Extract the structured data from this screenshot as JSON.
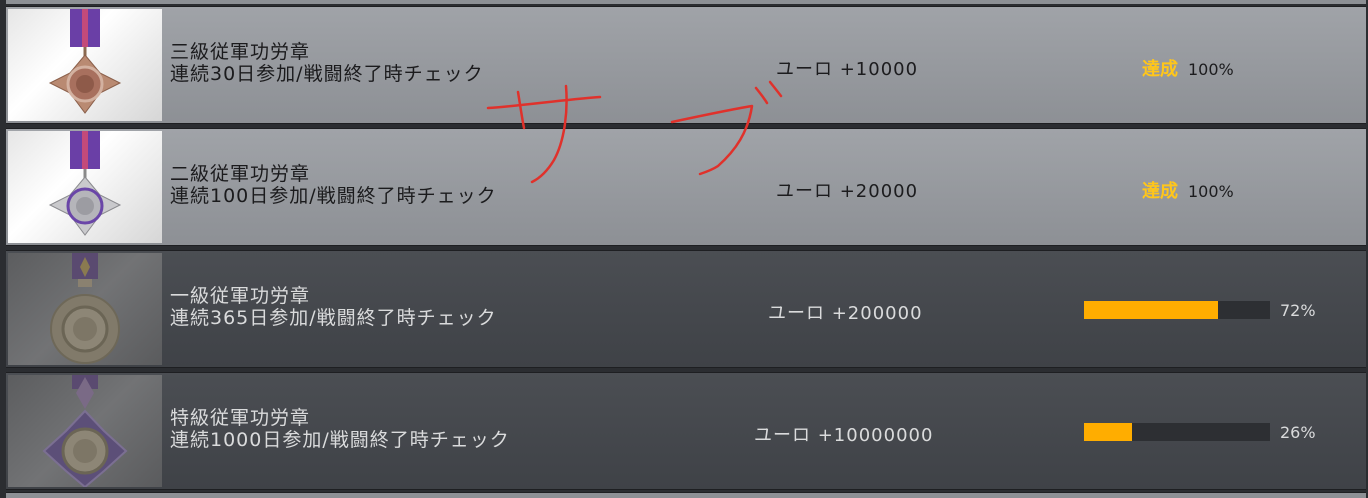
{
  "achievements": [
    {
      "name": "三級従軍功労章",
      "condition": "連続30日参加/戦闘終了時チェック",
      "reward": "ユーロ +10000",
      "completed": true,
      "status_label": "達成",
      "percent_label": "100%",
      "progress": 1.0,
      "medal_variant": "bronze"
    },
    {
      "name": "二級従軍功労章",
      "condition": "連続100日参加/戦闘終了時チェック",
      "reward": "ユーロ +20000",
      "completed": true,
      "status_label": "達成",
      "percent_label": "100%",
      "progress": 1.0,
      "medal_variant": "silver"
    },
    {
      "name": "一級従軍功労章",
      "condition": "連続365日参加/戦闘終了時チェック",
      "reward": "ユーロ +200000",
      "completed": false,
      "percent_label": "72%",
      "progress": 0.72,
      "medal_variant": "gold-locked"
    },
    {
      "name": "特級従軍功労章",
      "condition": "連続1000日参加/戦闘終了時チェック",
      "reward": "ユーロ +10000000",
      "completed": false,
      "percent_label": "26%",
      "progress": 0.26,
      "medal_variant": "special-locked"
    }
  ],
  "annotation": {
    "text": "サブ",
    "color": "#e0312b"
  },
  "colors": {
    "achieved": "#ffc61a",
    "progress_fill": "#ffad00",
    "completed_row": "#9a9da2",
    "pending_row": "#45484d"
  }
}
